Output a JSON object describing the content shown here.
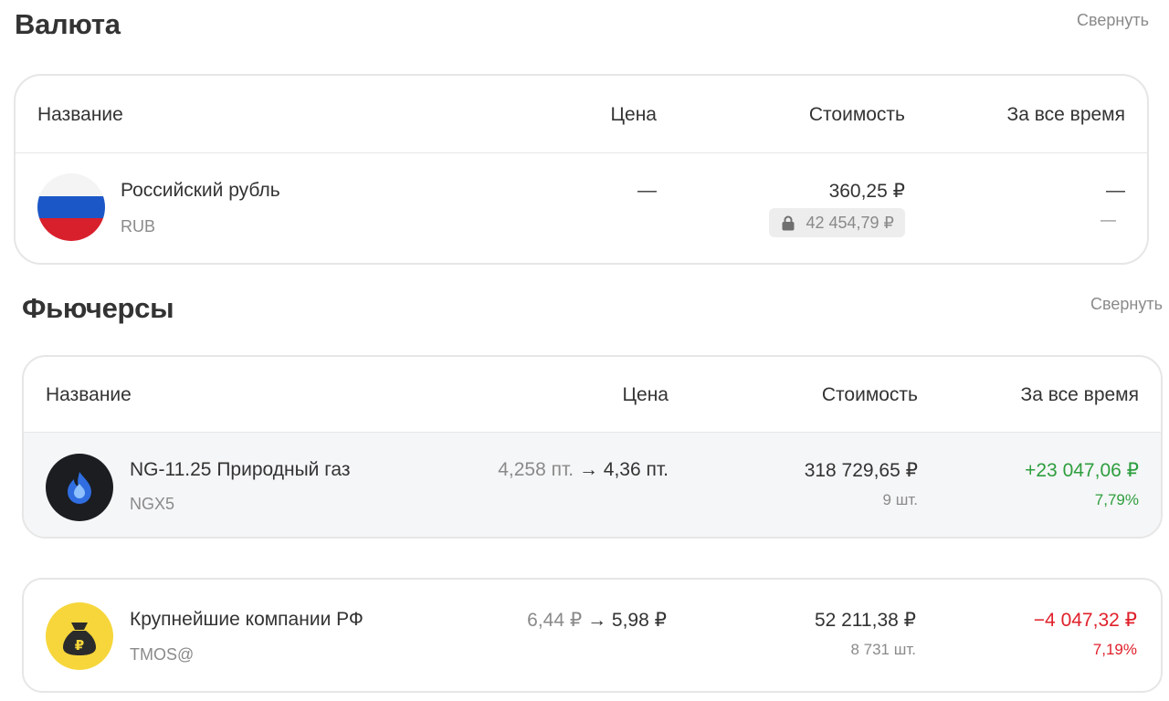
{
  "currency": {
    "title": "Валюта",
    "collapse_label": "Свернуть",
    "columns": {
      "name": "Название",
      "price": "Цена",
      "value": "Стоимость",
      "alltime": "За все время"
    },
    "rows": [
      {
        "name": "Российский рубль",
        "ticker": "RUB",
        "price": "—",
        "value": "360,25 ₽",
        "locked_value": "42 454,79 ₽",
        "alltime": "—",
        "alltime_sub": "—"
      }
    ]
  },
  "futures": {
    "title": "Фьючерсы",
    "collapse_label": "Свернуть",
    "columns": {
      "name": "Название",
      "price": "Цена",
      "value": "Стоимость",
      "alltime": "За все время"
    },
    "rows": [
      {
        "name": "NG-11.25 Природный газ",
        "ticker": "NGX5",
        "price_from": "4,258 пт.",
        "price_arrow": "→",
        "price_to": "4,36 пт.",
        "value": "318 729,65 ₽",
        "quantity": "9 шт.",
        "alltime": "+23 047,06 ₽",
        "alltime_pct": "7,79%",
        "icon": "gas-flame-icon"
      },
      {
        "name": "Крупнейшие компании РФ",
        "ticker": "TMOS@",
        "price_from": "6,44 ₽",
        "price_arrow": "→",
        "price_to": "5,98 ₽",
        "value": "52 211,38 ₽",
        "quantity": "8 731 шт.",
        "alltime": "−4 047,32 ₽",
        "alltime_pct": "7,19%",
        "icon": "money-bag-icon"
      }
    ]
  },
  "colors": {
    "positive": "#2e9e3e",
    "negative": "#e0202a",
    "muted": "#8a8a8a",
    "text": "#333333",
    "border": "#e6e6e6"
  }
}
